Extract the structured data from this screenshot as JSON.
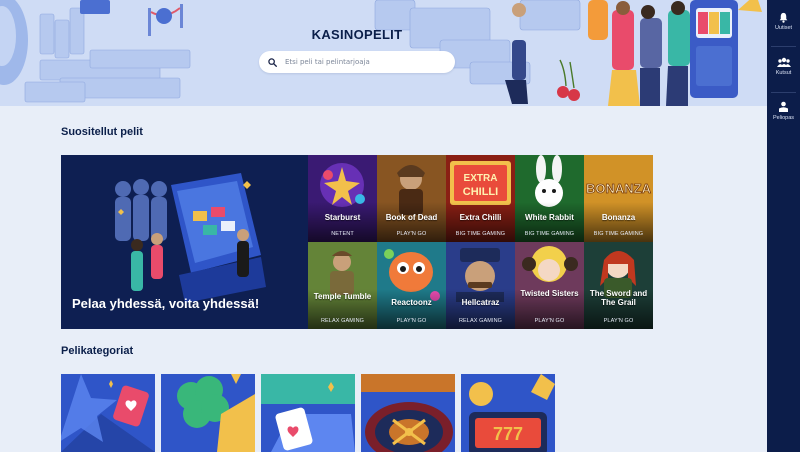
{
  "hero": {
    "title": "KASINOPELIT",
    "search_placeholder": "Etsi peli tai pelintarjoaja"
  },
  "rail": {
    "items": [
      {
        "label": "Uutiset",
        "icon": "bell-icon"
      },
      {
        "label": "Kutsut",
        "icon": "group-icon"
      },
      {
        "label": "Peliopas",
        "icon": "guide-icon"
      }
    ]
  },
  "recommended": {
    "title": "Suositellut pelit",
    "promo_text": "Pelaa yhdessä, voita yhdessä!",
    "games": [
      {
        "name": "Starburst",
        "provider": "NETENT",
        "color": "#3a1a73"
      },
      {
        "name": "Book of Dead",
        "provider": "PLAY'N GO",
        "color": "#6b3a16"
      },
      {
        "name": "Extra Chilli",
        "provider": "BIG TIME GAMING",
        "color": "#8a1f14"
      },
      {
        "name": "White Rabbit",
        "provider": "BIG TIME GAMING",
        "color": "#1f6a2d"
      },
      {
        "name": "Bonanza",
        "provider": "BIG TIME GAMING",
        "color": "#c07a14"
      },
      {
        "name": "Temple Tumble",
        "provider": "RELAX GAMING",
        "color": "#4d6a2a"
      },
      {
        "name": "Reactoonz",
        "provider": "PLAY'N GO",
        "color": "#1f7a8a"
      },
      {
        "name": "Hellcatraz",
        "provider": "RELAX GAMING",
        "color": "#2a3d8a"
      },
      {
        "name": "Twisted Sisters",
        "provider": "PLAY'N GO",
        "color": "#6e3a5c"
      },
      {
        "name": "The Sword and The Grail",
        "provider": "PLAY'N GO",
        "color": "#1d3f38"
      }
    ]
  },
  "categories": {
    "title": "Pelikategoriat",
    "items": [
      {
        "icon": "heart-card-icon",
        "color": "#2f55c8"
      },
      {
        "icon": "clover-icon",
        "color": "#2f55c8"
      },
      {
        "icon": "cards-icon",
        "color": "#2f55c8"
      },
      {
        "icon": "roulette-icon",
        "color": "#2f55c8"
      },
      {
        "icon": "slot-777-icon",
        "color": "#2f55c8"
      }
    ]
  }
}
